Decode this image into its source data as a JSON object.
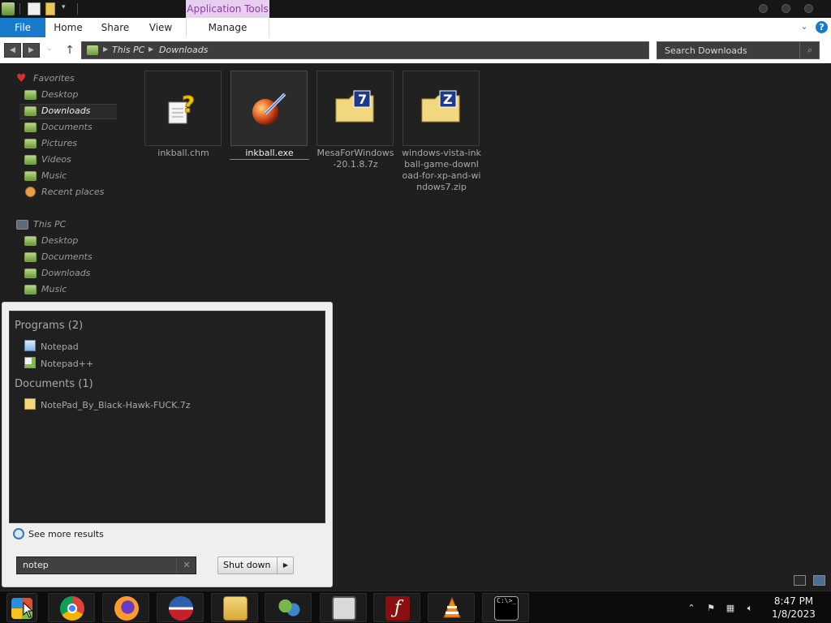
{
  "titlebar": {
    "context_tab": "Application Tools"
  },
  "ribbon": {
    "tabs": [
      "File",
      "Home",
      "Share",
      "View",
      "Manage"
    ]
  },
  "address": {
    "crumbs": [
      "This PC",
      "Downloads"
    ],
    "search_placeholder": "Search Downloads"
  },
  "nav": {
    "favorites_header": "Favorites",
    "favorites": [
      "Desktop",
      "Downloads",
      "Documents",
      "Pictures",
      "Videos",
      "Music",
      "Recent places"
    ],
    "pc_header": "This PC",
    "pc_items": [
      "Desktop",
      "Documents",
      "Downloads",
      "Music"
    ]
  },
  "files": [
    {
      "name": "inkball.chm"
    },
    {
      "name": "inkball.exe"
    },
    {
      "name": "MesaForWindows-20.1.8.7z"
    },
    {
      "name": "windows-vista-inkball-game-download-for-xp-and-windows7.zip"
    }
  ],
  "start_menu": {
    "programs_header": "Programs (2)",
    "programs": [
      "Notepad",
      "Notepad++"
    ],
    "documents_header": "Documents (1)",
    "documents": [
      "NotePad_By_Black-Hawk-FUCK.7z"
    ],
    "see_more": "See more results",
    "search_value": "notep",
    "shutdown_label": "Shut down"
  },
  "taskbar": {
    "time": "8:47 PM",
    "date": "1/8/2023"
  },
  "colors": {
    "file_tab": "#1979ca",
    "app_tools_bg": "#e7d0ef",
    "app_tools_text": "#8a3da0",
    "window_bg": "#1f1f1f"
  }
}
